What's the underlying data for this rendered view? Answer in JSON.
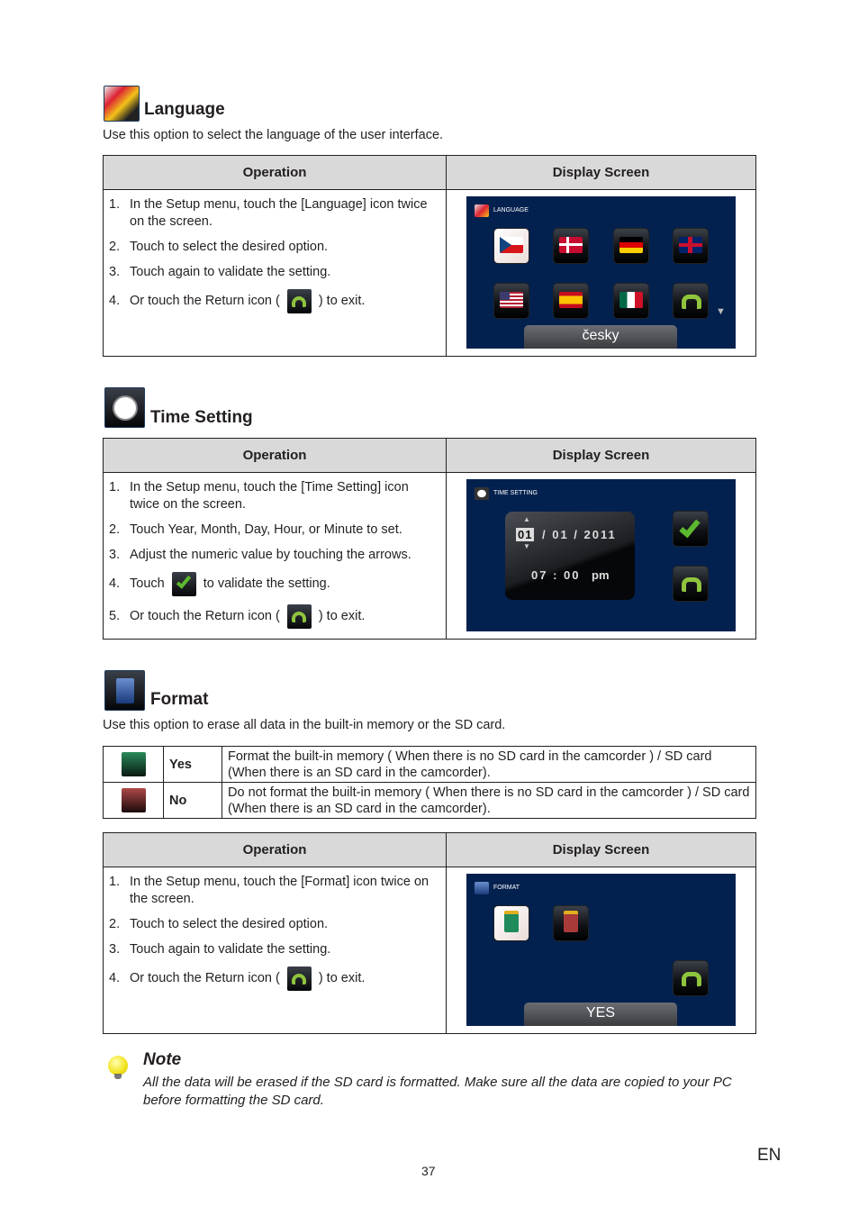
{
  "language": {
    "title": "Language",
    "icon": "language-flags-icon",
    "description": "Use this option to select the language of the user interface.",
    "table_headers": {
      "operation": "Operation",
      "display": "Display Screen"
    },
    "steps": [
      {
        "n": "1.",
        "text": "In the Setup menu, touch the [Language] icon twice on the screen."
      },
      {
        "n": "2.",
        "text": "Touch to select the desired option."
      },
      {
        "n": "3.",
        "text": "Touch again to validate the setting."
      },
      {
        "n": "4.",
        "before": "Or touch the Return icon (",
        "after": ") to exit."
      }
    ],
    "screen": {
      "title": "LANGUAGE",
      "flags": [
        "czech-flag",
        "danish-flag",
        "german-flag",
        "uk-flag",
        "us-flag",
        "spanish-flag",
        "mexican-flag",
        "return"
      ],
      "selected_label": "česky",
      "scroll_indicator": "▼"
    }
  },
  "time_setting": {
    "title": "Time Setting",
    "icon": "clock-icon",
    "table_headers": {
      "operation": "Operation",
      "display": "Display Screen"
    },
    "steps": [
      {
        "n": "1.",
        "text": "In the Setup menu, touch the [Time Setting] icon twice on the screen."
      },
      {
        "n": "2.",
        "text": "Touch Year, Month, Day, Hour, or Minute to set."
      },
      {
        "n": "3.",
        "text": "Adjust the numeric value by touching the arrows."
      },
      {
        "n": "4.",
        "before": "Touch",
        "after": "to validate the setting."
      },
      {
        "n": "5.",
        "before": "Or touch the Return icon (",
        "after": ") to exit."
      }
    ],
    "screen": {
      "title": "TIME SETTING",
      "selected_field": "01",
      "date_rest": "/ 01 / 2011",
      "time": "07 : 00",
      "ampm": "pm",
      "arrow_up": "▲",
      "arrow_down": "▼"
    }
  },
  "format": {
    "title": "Format",
    "icon": "sd-card-icon",
    "description": "Use this option to erase all data in the built-in memory or the SD card.",
    "options": [
      {
        "label": "Yes",
        "icon": "sd-card-green-icon",
        "text": "Format the built-in memory ( When there is no SD card in the camcorder ) / SD card (When there is an SD card in the camcorder)."
      },
      {
        "label": "No",
        "icon": "sd-card-red-icon",
        "text": "Do not format the built-in memory ( When there is no SD card in the camcorder ) / SD card (When there is an SD card in the camcorder)."
      }
    ],
    "table_headers": {
      "operation": "Operation",
      "display": "Display Screen"
    },
    "steps": [
      {
        "n": "1.",
        "text": "In the Setup menu, touch the [Format] icon twice on the screen."
      },
      {
        "n": "2.",
        "text": "Touch to select the desired option."
      },
      {
        "n": "3.",
        "text": "Touch again to validate the setting."
      },
      {
        "n": "4.",
        "before": "Or touch the Return icon (",
        "after": ") to exit."
      }
    ],
    "screen": {
      "title": "FORMAT",
      "selected_label": "YES"
    }
  },
  "note": {
    "title": "Note",
    "text": "All the data will be erased if the SD card is formatted. Make sure all the data are copied to your PC before formatting the SD card."
  },
  "footer": {
    "page_number": "37",
    "language_code": "EN"
  },
  "colors": {
    "screen_bg": "#03214f",
    "header_bg": "#d9d9d9",
    "return_green": "#8fc43d",
    "check_green": "#5cb82e"
  }
}
